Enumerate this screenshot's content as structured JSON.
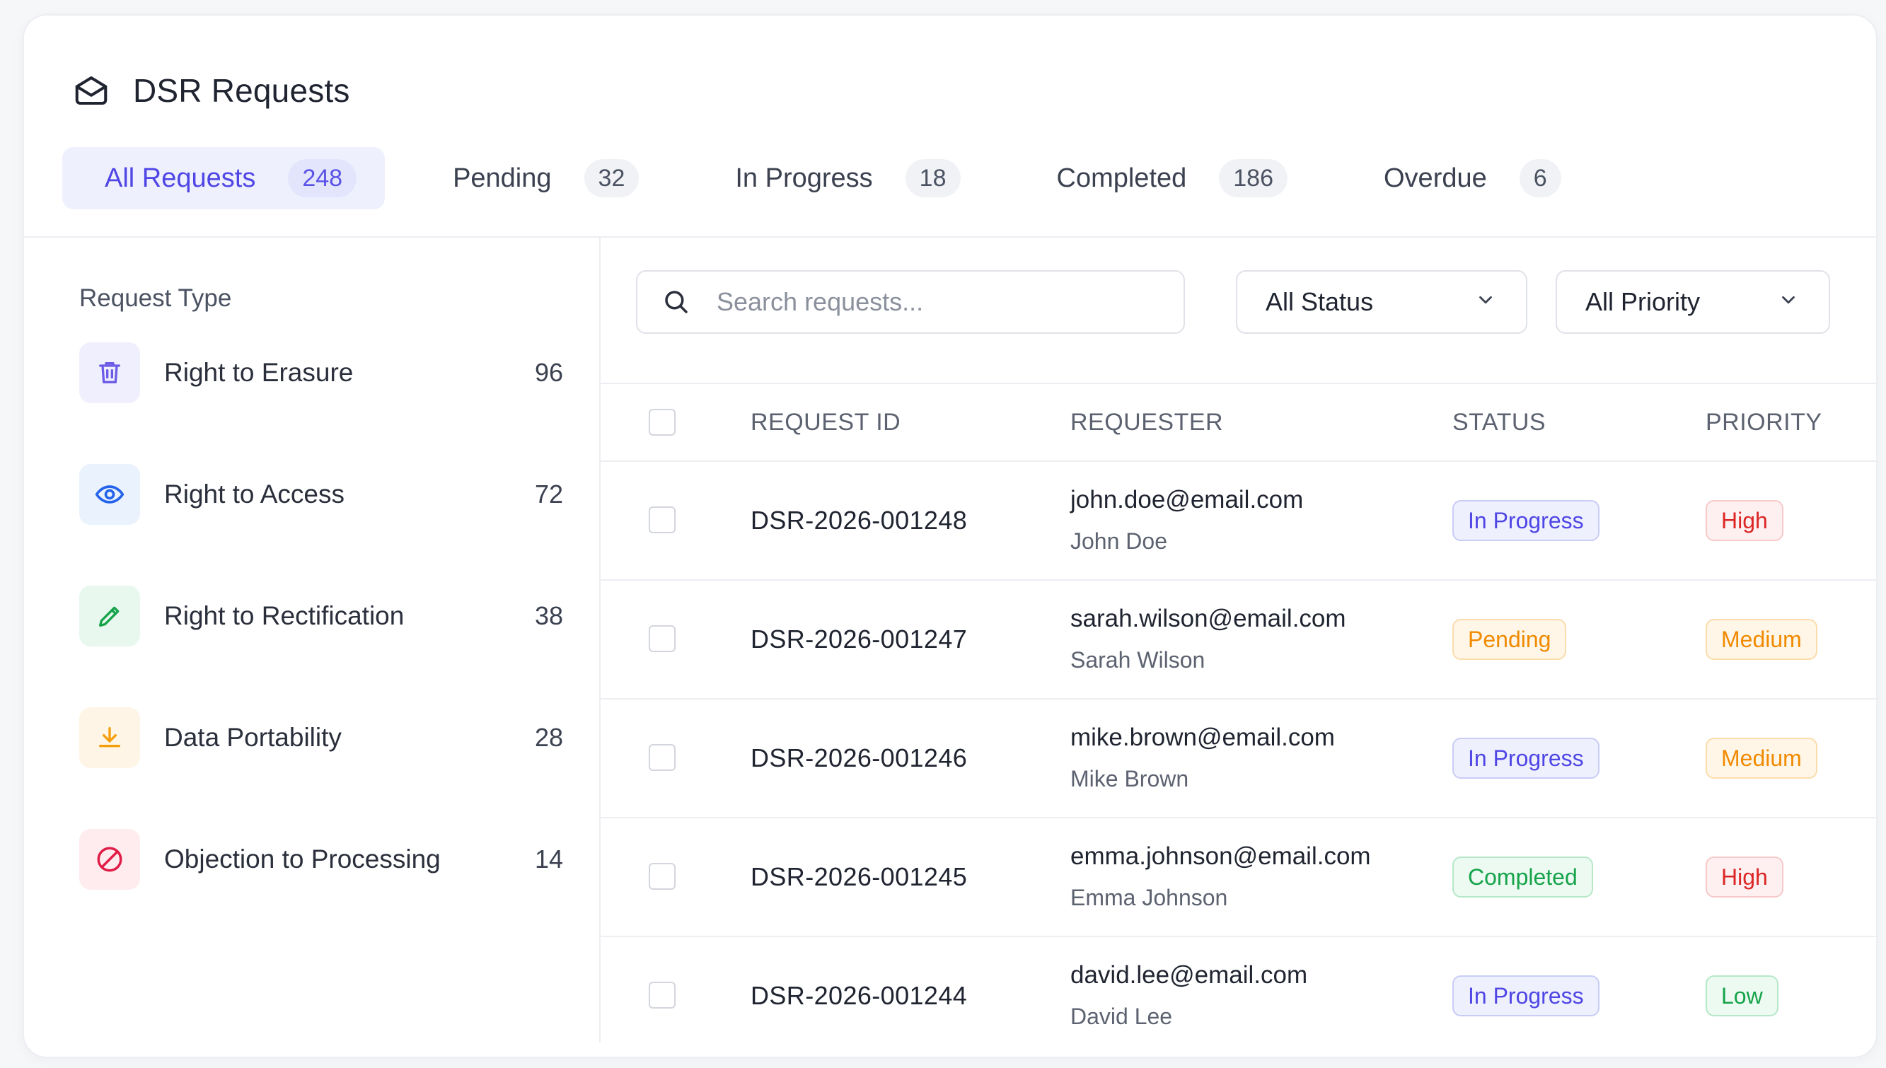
{
  "header": {
    "title": "DSR Requests",
    "icon": "mail-icon"
  },
  "tabs": [
    {
      "label": "All Requests",
      "count": "248",
      "active": true
    },
    {
      "label": "Pending",
      "count": "32"
    },
    {
      "label": "In Progress",
      "count": "18"
    },
    {
      "label": "Completed",
      "count": "186"
    },
    {
      "label": "Overdue",
      "count": "6"
    }
  ],
  "sidebar": {
    "heading": "Request Type",
    "items": [
      {
        "label": "Right to Erasure",
        "count": "96",
        "icon": "trash-icon",
        "color": "#6d5ce7",
        "bg": "#f0effd"
      },
      {
        "label": "Right to Access",
        "count": "72",
        "icon": "eye-icon",
        "color": "#2563eb",
        "bg": "#eaf2fe"
      },
      {
        "label": "Right to Rectification",
        "count": "38",
        "icon": "pencil-icon",
        "color": "#16a34a",
        "bg": "#e8f8ee"
      },
      {
        "label": "Data Portability",
        "count": "28",
        "icon": "download-icon",
        "color": "#f59e0b",
        "bg": "#fff5e6"
      },
      {
        "label": "Objection to Processing",
        "count": "14",
        "icon": "block-icon",
        "color": "#e11d48",
        "bg": "#feecef"
      }
    ]
  },
  "search": {
    "placeholder": "Search requests...",
    "value": ""
  },
  "filters": {
    "status": "All Status",
    "priority": "All Priority"
  },
  "table": {
    "headers": {
      "id": "REQUEST ID",
      "requester": "REQUESTER",
      "status": "STATUS",
      "priority": "PRIORITY"
    },
    "rows": [
      {
        "id": "DSR-2026-001248",
        "email": "john.doe@email.com",
        "name": "John Doe",
        "status": "In Progress",
        "priority": "High"
      },
      {
        "id": "DSR-2026-001247",
        "email": "sarah.wilson@email.com",
        "name": "Sarah Wilson",
        "status": "Pending",
        "priority": "Medium"
      },
      {
        "id": "DSR-2026-001246",
        "email": "mike.brown@email.com",
        "name": "Mike Brown",
        "status": "In Progress",
        "priority": "Medium"
      },
      {
        "id": "DSR-2026-001245",
        "email": "emma.johnson@email.com",
        "name": "Emma Johnson",
        "status": "Completed",
        "priority": "High"
      },
      {
        "id": "DSR-2026-001244",
        "email": "david.lee@email.com",
        "name": "David Lee",
        "status": "In Progress",
        "priority": "Low"
      }
    ]
  },
  "badge_colors": {
    "In Progress": {
      "fg": "#4f46e5",
      "bg": "#eef0fd",
      "border": "#c9ccf6"
    },
    "Pending": {
      "fg": "#f08a00",
      "bg": "#fff6e8",
      "border": "#fbdcaa"
    },
    "Completed": {
      "fg": "#16a34a",
      "bg": "#ecfaf1",
      "border": "#b6e8c8"
    },
    "High": {
      "fg": "#dc2626",
      "bg": "#fef0f0",
      "border": "#f7c9c9"
    },
    "Medium": {
      "fg": "#f08a00",
      "bg": "#fff6e8",
      "border": "#fbdcaa"
    },
    "Low": {
      "fg": "#16a34a",
      "bg": "#ecfaf1",
      "border": "#b6e8c8"
    }
  }
}
